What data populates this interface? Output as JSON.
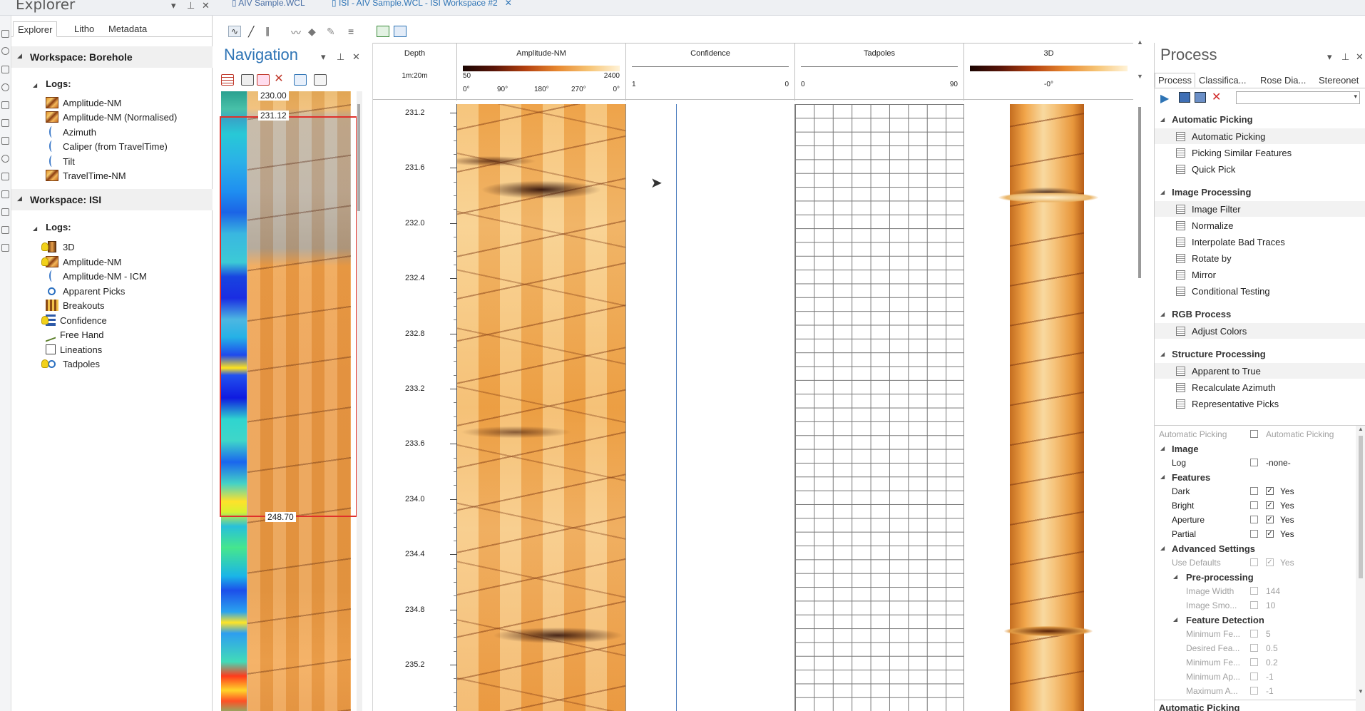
{
  "colors": {
    "accent": "#2e74b5",
    "range_box": "#e0302a",
    "grid": "#777777",
    "confidence_line": "#4e7fc0"
  },
  "top": {
    "explorer_title": "Explorer",
    "doc_tabs": [
      "AIV Sample.WCL",
      "ISI - AIV Sample.WCL - ISI Workspace #2"
    ]
  },
  "explorer": {
    "tabs": [
      "Explorer",
      "Litho",
      "Metadata"
    ],
    "workspaces": [
      {
        "label": "Workspace: Borehole",
        "logs_label": "Logs:",
        "items": [
          {
            "label": "Amplitude-NM",
            "icon": "image-log-icon"
          },
          {
            "label": "Amplitude-NM (Normalised)",
            "icon": "image-log-icon"
          },
          {
            "label": "Azimuth",
            "icon": "curve-icon"
          },
          {
            "label": "Caliper (from TravelTime)",
            "icon": "curve-icon"
          },
          {
            "label": "Tilt",
            "icon": "curve-icon"
          },
          {
            "label": "TravelTime-NM",
            "icon": "image-log-icon"
          }
        ]
      },
      {
        "label": "Workspace: ISI",
        "logs_label": "Logs:",
        "items": [
          {
            "label": "3D",
            "icon": "3d-icon",
            "visible": true
          },
          {
            "label": "Amplitude-NM",
            "icon": "image-log-icon",
            "visible": true
          },
          {
            "label": "Amplitude-NM - ICM",
            "icon": "curve-icon",
            "visible": false
          },
          {
            "label": "Apparent Picks",
            "icon": "pick-icon",
            "visible": false
          },
          {
            "label": "Breakouts",
            "icon": "breakout-icon",
            "visible": false
          },
          {
            "label": "Confidence",
            "icon": "bar-icon",
            "visible": true
          },
          {
            "label": "Free Hand",
            "icon": "freehand-icon",
            "visible": false
          },
          {
            "label": "Lineations",
            "icon": "lineation-icon",
            "visible": false
          },
          {
            "label": "Tadpoles",
            "icon": "pick-icon",
            "visible": true
          }
        ]
      }
    ]
  },
  "navigation": {
    "title": "Navigation",
    "depth_top": "230.00",
    "range_start": "231.12",
    "range_end": "248.70"
  },
  "tracks": {
    "depth": {
      "title": "Depth",
      "scale": "1m:20m",
      "labels": [
        "231.2",
        "231.6",
        "232.0",
        "232.4",
        "232.8",
        "233.2",
        "233.6",
        "234.0",
        "234.4",
        "234.8",
        "235.2"
      ]
    },
    "amplitude": {
      "title": "Amplitude-NM",
      "min": "50",
      "max": "2400",
      "azimuths": [
        "0°",
        "90°",
        "180°",
        "270°",
        "0°"
      ]
    },
    "confidence": {
      "title": "Confidence",
      "left": "1",
      "right": "0"
    },
    "tadpoles": {
      "title": "Tadpoles",
      "left": "0",
      "right": "90"
    },
    "view3d": {
      "title": "3D",
      "angle": "-0°"
    }
  },
  "process": {
    "title": "Process",
    "tabs": [
      "Process",
      "Classifica...",
      "Rose Dia...",
      "Stereonet"
    ],
    "categories": [
      {
        "label": "Automatic Picking",
        "items": [
          "Automatic Picking",
          "Picking Similar Features",
          "Quick Pick"
        ]
      },
      {
        "label": "Image Processing",
        "items": [
          "Image Filter",
          "Normalize",
          "Interpolate Bad Traces",
          "Rotate by",
          "Mirror",
          "Conditional Testing"
        ]
      },
      {
        "label": "RGB Process",
        "items": [
          "Adjust Colors"
        ]
      },
      {
        "label": "Structure Processing",
        "items": [
          "Apparent to True",
          "Recalculate Azimuth",
          "Representative Picks"
        ]
      }
    ],
    "properties": {
      "header_name": "Automatic Picking",
      "header_value": "Automatic Picking",
      "image_section": "Image",
      "log_name": "Log",
      "log_value": "-none-",
      "features_section": "Features",
      "dark": "Dark",
      "bright": "Bright",
      "aperture": "Aperture",
      "partial": "Partial",
      "yes": "Yes",
      "advanced_section": "Advanced Settings",
      "use_defaults": "Use Defaults",
      "preprocessing_section": "Pre-processing",
      "image_width": "Image Width",
      "image_width_value": "144",
      "image_smo": "Image Smo...",
      "image_smo_value": "10",
      "feature_detection_section": "Feature Detection",
      "min_fe1": "Minimum Fe...",
      "min_fe1_value": "5",
      "desired_fea": "Desired Fea...",
      "desired_fea_value": "0.5",
      "min_fe2": "Minimum Fe...",
      "min_fe2_value": "0.2",
      "min_ap": "Minimum Ap...",
      "min_ap_value": "-1",
      "max_a": "Maximum A...",
      "max_a_value": "-1",
      "footer": "Automatic Picking"
    }
  }
}
